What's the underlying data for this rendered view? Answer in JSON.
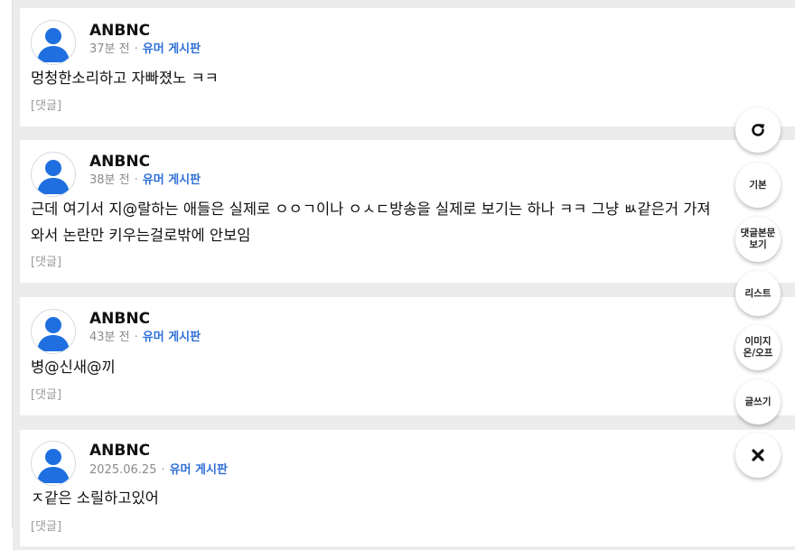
{
  "posts": [
    {
      "author": "ANBNC",
      "time": "37분 전",
      "separator": "·",
      "board": "유머 게시판",
      "content_lines": [
        "멍청한소리하고 자빠졌노 ㅋㅋ"
      ],
      "comment_label": "[댓글]"
    },
    {
      "author": "ANBNC",
      "time": "38분 전",
      "separator": "·",
      "board": "유머 게시판",
      "content_lines": [
        "근데 여기서 지@랄하는 애들은 실제로 ㅇㅇㄱ이나 ㅇㅅㄷ방송을 실제로 보기는 하나 ㅋㅋ 그냥 ㅄ같은거 가져",
        "와서 논란만 키우는걸로밖에 안보임"
      ],
      "comment_label": "[댓글]"
    },
    {
      "author": "ANBNC",
      "time": "43분 전",
      "separator": "·",
      "board": "유머 게시판",
      "content_lines": [
        "병@신새@끼"
      ],
      "comment_label": "[댓글]"
    },
    {
      "author": "ANBNC",
      "time": "2025.06.25",
      "separator": "·",
      "board": "유머 게시판",
      "content_lines": [
        "ㅈ같은 소릴하고있어"
      ],
      "comment_label": "[댓글]"
    }
  ],
  "floating_menu": {
    "refresh_icon": "refresh-icon",
    "default_label": "기본",
    "comment_view_label": "댓글본문 보기",
    "list_label": "리스트",
    "image_toggle_label": "이미지 온/오프",
    "write_label": "글쓰기",
    "close_icon": "close-icon"
  },
  "colors": {
    "board_link": "#2f6fd6",
    "avatar_blue": "#1f6fe0",
    "background": "#ececec"
  }
}
